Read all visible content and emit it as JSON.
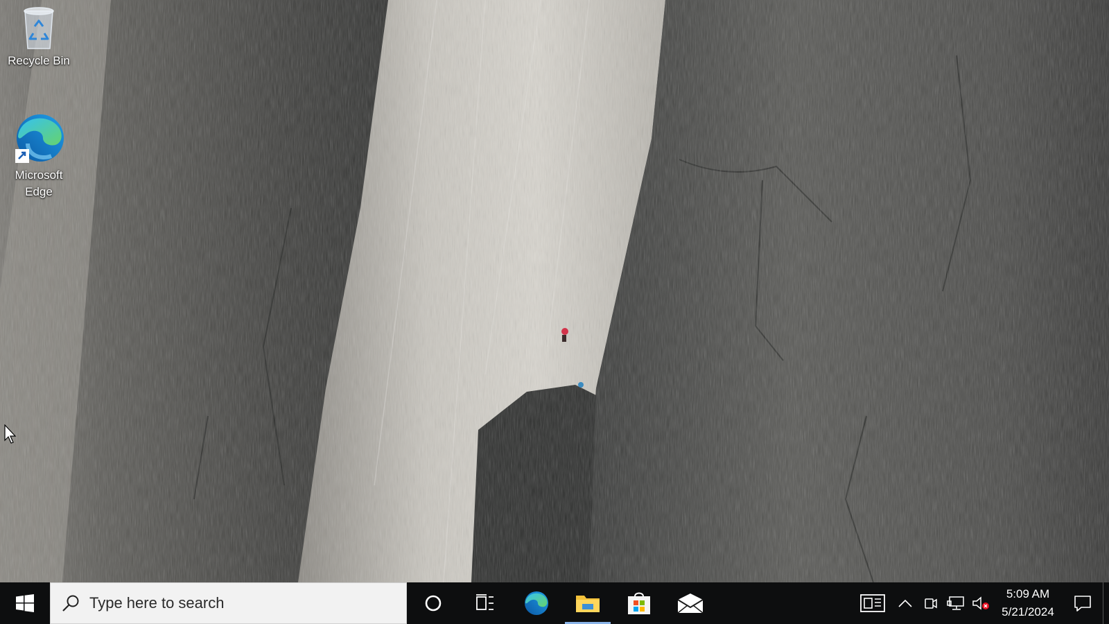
{
  "desktop": {
    "icons": [
      {
        "label": "Recycle Bin",
        "icon": "recycle-bin-icon"
      },
      {
        "label": "Microsoft Edge",
        "icon": "edge-icon"
      }
    ],
    "wallpaper": "granite-cliff-climbers"
  },
  "taskbar": {
    "start_icon": "windows-logo-icon",
    "search": {
      "placeholder": "Type here to search",
      "icon": "search-icon"
    },
    "apps": [
      {
        "name": "Cortana",
        "icon": "cortana-circle-icon",
        "active": false
      },
      {
        "name": "Task View",
        "icon": "task-view-icon",
        "active": false
      },
      {
        "name": "Microsoft Edge",
        "icon": "edge-icon",
        "active": false
      },
      {
        "name": "File Explorer",
        "icon": "folder-icon",
        "active": true
      },
      {
        "name": "Microsoft Store",
        "icon": "store-bag-icon",
        "active": false
      },
      {
        "name": "Mail",
        "icon": "mail-icon",
        "active": false
      }
    ],
    "tray": {
      "icons": [
        "news-icon",
        "chevron-up-icon",
        "meet-now-icon",
        "network-icon",
        "volume-muted-icon"
      ],
      "time": "5:09 AM",
      "date": "5/21/2024",
      "notification_icon": "action-center-icon"
    }
  },
  "colors": {
    "taskbar_bg": "#0d0e0f",
    "search_bg": "#f2f2f2",
    "active_indicator": "#8ab4e8",
    "edge_blue": "#1f7fd6",
    "edge_green": "#5fcf6a"
  }
}
